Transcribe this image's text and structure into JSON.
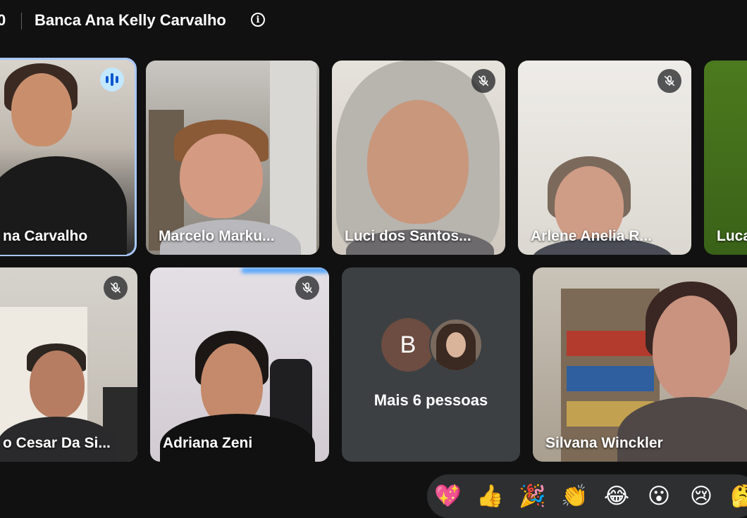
{
  "header": {
    "time_fragment": "0",
    "meeting_title": "Banca Ana Kelly Carvalho",
    "info_icon": "info-icon"
  },
  "participants": [
    {
      "name": "na Carvalho",
      "mic": "speaking"
    },
    {
      "name": "Marcelo Marku...",
      "mic": "on"
    },
    {
      "name": "Luci dos Santos...",
      "mic": "muted"
    },
    {
      "name": "Arlene Anelia R...",
      "mic": "muted"
    },
    {
      "name": "Luca",
      "mic": "on"
    },
    {
      "name": "o Cesar Da Si...",
      "mic": "muted"
    },
    {
      "name": "Adriana Zeni",
      "mic": "muted"
    },
    {
      "name": "Silvana Winckler",
      "mic": "on"
    }
  ],
  "more_people": {
    "avatar_letter": "B",
    "label": "Mais 6 pessoas"
  },
  "reactions": [
    "💖",
    "👍",
    "🎉",
    "👏",
    "😂",
    "😮",
    "😢",
    "🤔"
  ],
  "colors": {
    "background": "#111111",
    "active_outline": "#a8c7fa",
    "speaking_badge": "#c2e7ff",
    "tile_placeholder": "#3c4043"
  }
}
